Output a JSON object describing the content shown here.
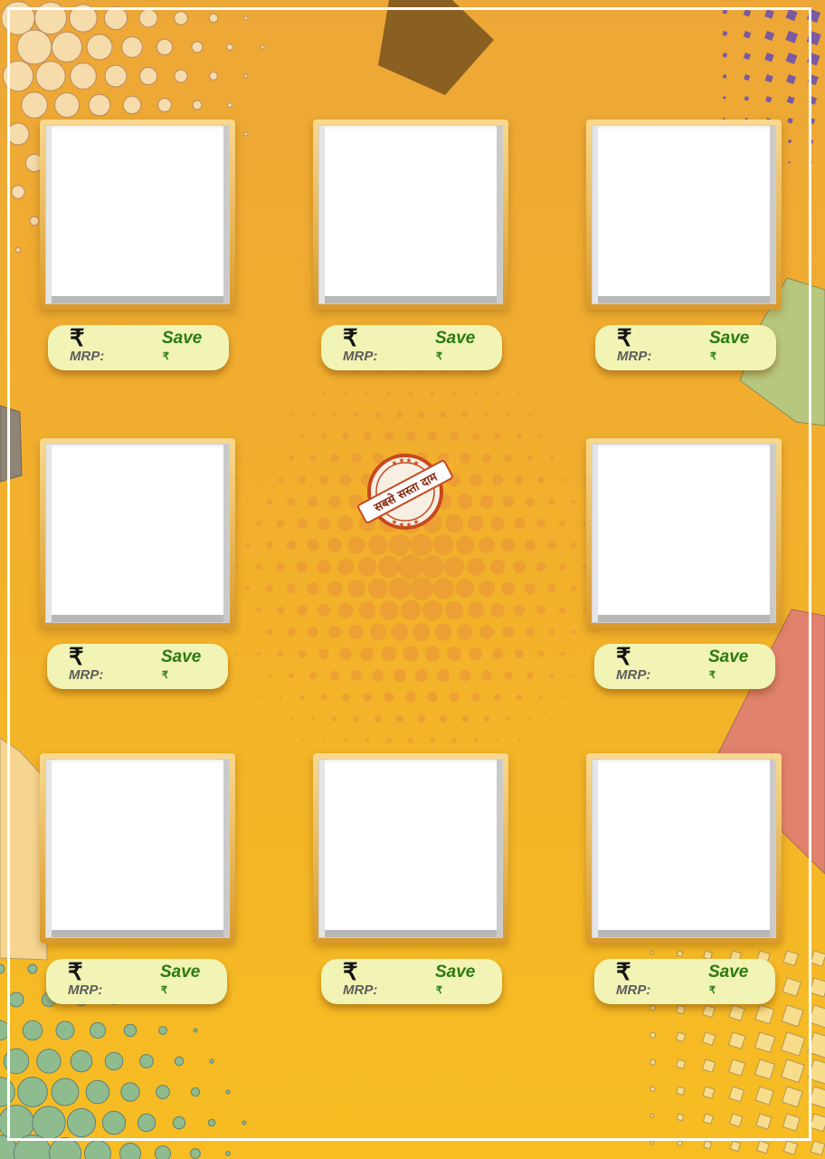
{
  "seal": {
    "text": "सबसे सस्ता दाम"
  },
  "product_slots": [
    {
      "currency": "₹",
      "mrp_label": "MRP:",
      "save_label": "Save",
      "save_currency": "₹"
    },
    {
      "currency": "₹",
      "mrp_label": "MRP:",
      "save_label": "Save",
      "save_currency": "₹"
    },
    {
      "currency": "₹",
      "mrp_label": "MRP:",
      "save_label": "Save",
      "save_currency": "₹"
    },
    {
      "currency": "₹",
      "mrp_label": "MRP:",
      "save_label": "Save",
      "save_currency": "₹"
    },
    {
      "currency": "₹",
      "mrp_label": "MRP:",
      "save_label": "Save",
      "save_currency": "₹"
    },
    {
      "currency": "₹",
      "mrp_label": "MRP:",
      "save_label": "Save",
      "save_currency": "₹"
    },
    {
      "currency": "₹",
      "mrp_label": "MRP:",
      "save_label": "Save",
      "save_currency": "₹"
    },
    {
      "currency": "₹",
      "mrp_label": "MRP:",
      "save_label": "Save",
      "save_currency": "₹"
    }
  ],
  "colors": {
    "background": "#f2b02c",
    "tag_fill": "#f1f4b4",
    "save_text": "#2b7a12",
    "seal_red": "#c8481e"
  }
}
